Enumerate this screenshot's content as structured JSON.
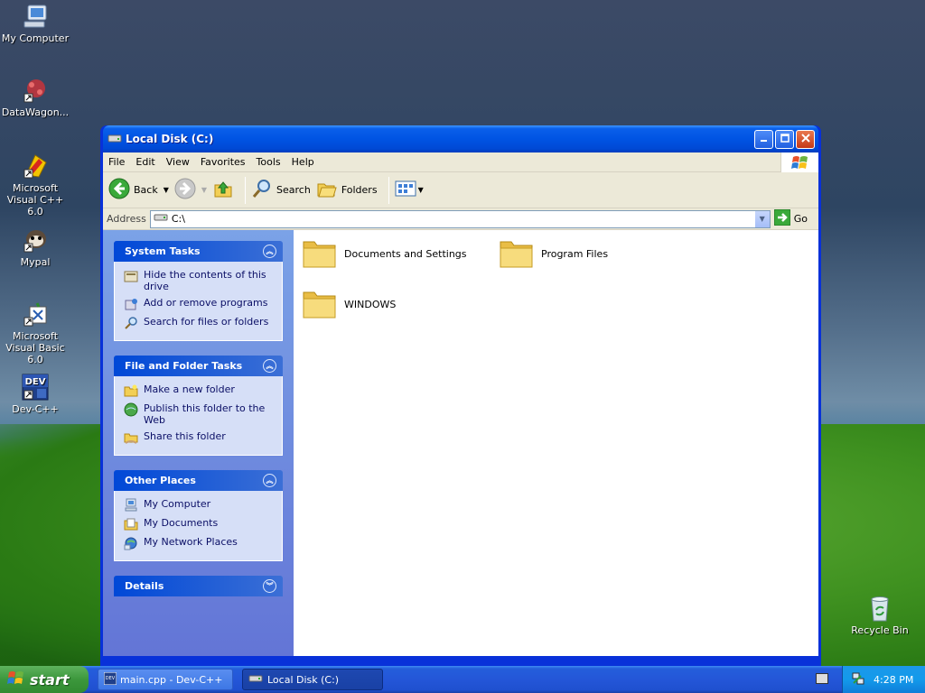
{
  "desktop": {
    "icons": [
      {
        "label": "My Computer"
      },
      {
        "label": "DataWagon..."
      },
      {
        "label": "Microsoft Visual C++ 6.0"
      },
      {
        "label": "Mypal"
      },
      {
        "label": "Microsoft Visual Basic 6.0"
      },
      {
        "label": "Dev-C++"
      },
      {
        "label": "Recycle Bin"
      }
    ]
  },
  "window": {
    "title": "Local Disk (C:)",
    "menu": [
      "File",
      "Edit",
      "View",
      "Favorites",
      "Tools",
      "Help"
    ],
    "toolbar": {
      "back": "Back",
      "search": "Search",
      "folders": "Folders"
    },
    "address": {
      "label": "Address",
      "value": "C:\\",
      "go": "Go"
    },
    "tasks": [
      {
        "title": "System Tasks",
        "items": [
          "Hide the contents of this drive",
          "Add or remove programs",
          "Search for files or folders"
        ]
      },
      {
        "title": "File and Folder Tasks",
        "items": [
          "Make a new folder",
          "Publish this folder to the Web",
          "Share this folder"
        ]
      },
      {
        "title": "Other Places",
        "items": [
          "My Computer",
          "My Documents",
          "My Network Places"
        ]
      },
      {
        "title": "Details",
        "items": []
      }
    ],
    "files": [
      "Documents and Settings",
      "Program Files",
      "WINDOWS"
    ]
  },
  "taskbar": {
    "start": "start",
    "tasks": [
      "main.cpp - Dev-C++",
      "Local Disk (C:)"
    ],
    "clock": "4:28 PM"
  },
  "colors": {
    "titlebar": "#0054e3",
    "taskpane": "#6375d6",
    "start": "#3c973c"
  }
}
